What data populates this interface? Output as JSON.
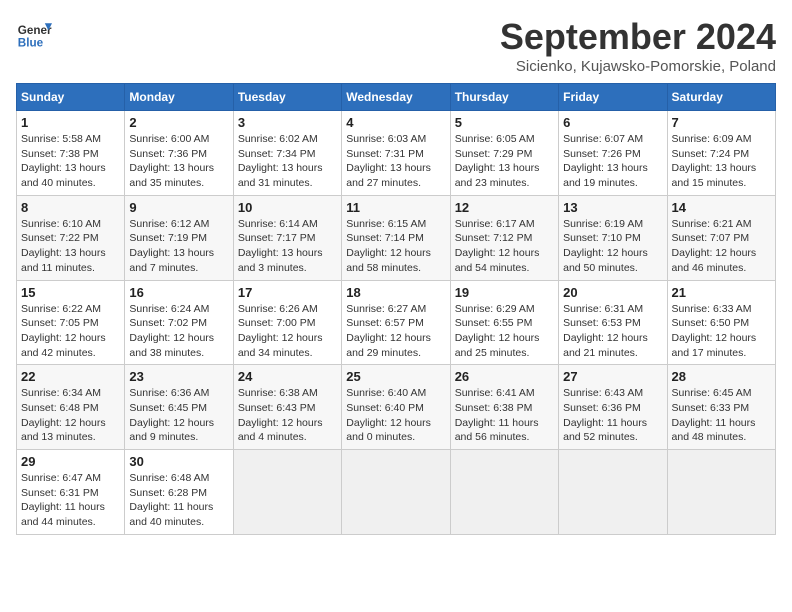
{
  "header": {
    "logo_line1": "General",
    "logo_line2": "Blue",
    "month": "September 2024",
    "location": "Sicienko, Kujawsko-Pomorskie, Poland"
  },
  "weekdays": [
    "Sunday",
    "Monday",
    "Tuesday",
    "Wednesday",
    "Thursday",
    "Friday",
    "Saturday"
  ],
  "weeks": [
    [
      {
        "day": "1",
        "lines": [
          "Sunrise: 5:58 AM",
          "Sunset: 7:38 PM",
          "Daylight: 13 hours",
          "and 40 minutes."
        ]
      },
      {
        "day": "2",
        "lines": [
          "Sunrise: 6:00 AM",
          "Sunset: 7:36 PM",
          "Daylight: 13 hours",
          "and 35 minutes."
        ]
      },
      {
        "day": "3",
        "lines": [
          "Sunrise: 6:02 AM",
          "Sunset: 7:34 PM",
          "Daylight: 13 hours",
          "and 31 minutes."
        ]
      },
      {
        "day": "4",
        "lines": [
          "Sunrise: 6:03 AM",
          "Sunset: 7:31 PM",
          "Daylight: 13 hours",
          "and 27 minutes."
        ]
      },
      {
        "day": "5",
        "lines": [
          "Sunrise: 6:05 AM",
          "Sunset: 7:29 PM",
          "Daylight: 13 hours",
          "and 23 minutes."
        ]
      },
      {
        "day": "6",
        "lines": [
          "Sunrise: 6:07 AM",
          "Sunset: 7:26 PM",
          "Daylight: 13 hours",
          "and 19 minutes."
        ]
      },
      {
        "day": "7",
        "lines": [
          "Sunrise: 6:09 AM",
          "Sunset: 7:24 PM",
          "Daylight: 13 hours",
          "and 15 minutes."
        ]
      }
    ],
    [
      {
        "day": "8",
        "lines": [
          "Sunrise: 6:10 AM",
          "Sunset: 7:22 PM",
          "Daylight: 13 hours",
          "and 11 minutes."
        ]
      },
      {
        "day": "9",
        "lines": [
          "Sunrise: 6:12 AM",
          "Sunset: 7:19 PM",
          "Daylight: 13 hours",
          "and 7 minutes."
        ]
      },
      {
        "day": "10",
        "lines": [
          "Sunrise: 6:14 AM",
          "Sunset: 7:17 PM",
          "Daylight: 13 hours",
          "and 3 minutes."
        ]
      },
      {
        "day": "11",
        "lines": [
          "Sunrise: 6:15 AM",
          "Sunset: 7:14 PM",
          "Daylight: 12 hours",
          "and 58 minutes."
        ]
      },
      {
        "day": "12",
        "lines": [
          "Sunrise: 6:17 AM",
          "Sunset: 7:12 PM",
          "Daylight: 12 hours",
          "and 54 minutes."
        ]
      },
      {
        "day": "13",
        "lines": [
          "Sunrise: 6:19 AM",
          "Sunset: 7:10 PM",
          "Daylight: 12 hours",
          "and 50 minutes."
        ]
      },
      {
        "day": "14",
        "lines": [
          "Sunrise: 6:21 AM",
          "Sunset: 7:07 PM",
          "Daylight: 12 hours",
          "and 46 minutes."
        ]
      }
    ],
    [
      {
        "day": "15",
        "lines": [
          "Sunrise: 6:22 AM",
          "Sunset: 7:05 PM",
          "Daylight: 12 hours",
          "and 42 minutes."
        ]
      },
      {
        "day": "16",
        "lines": [
          "Sunrise: 6:24 AM",
          "Sunset: 7:02 PM",
          "Daylight: 12 hours",
          "and 38 minutes."
        ]
      },
      {
        "day": "17",
        "lines": [
          "Sunrise: 6:26 AM",
          "Sunset: 7:00 PM",
          "Daylight: 12 hours",
          "and 34 minutes."
        ]
      },
      {
        "day": "18",
        "lines": [
          "Sunrise: 6:27 AM",
          "Sunset: 6:57 PM",
          "Daylight: 12 hours",
          "and 29 minutes."
        ]
      },
      {
        "day": "19",
        "lines": [
          "Sunrise: 6:29 AM",
          "Sunset: 6:55 PM",
          "Daylight: 12 hours",
          "and 25 minutes."
        ]
      },
      {
        "day": "20",
        "lines": [
          "Sunrise: 6:31 AM",
          "Sunset: 6:53 PM",
          "Daylight: 12 hours",
          "and 21 minutes."
        ]
      },
      {
        "day": "21",
        "lines": [
          "Sunrise: 6:33 AM",
          "Sunset: 6:50 PM",
          "Daylight: 12 hours",
          "and 17 minutes."
        ]
      }
    ],
    [
      {
        "day": "22",
        "lines": [
          "Sunrise: 6:34 AM",
          "Sunset: 6:48 PM",
          "Daylight: 12 hours",
          "and 13 minutes."
        ]
      },
      {
        "day": "23",
        "lines": [
          "Sunrise: 6:36 AM",
          "Sunset: 6:45 PM",
          "Daylight: 12 hours",
          "and 9 minutes."
        ]
      },
      {
        "day": "24",
        "lines": [
          "Sunrise: 6:38 AM",
          "Sunset: 6:43 PM",
          "Daylight: 12 hours",
          "and 4 minutes."
        ]
      },
      {
        "day": "25",
        "lines": [
          "Sunrise: 6:40 AM",
          "Sunset: 6:40 PM",
          "Daylight: 12 hours",
          "and 0 minutes."
        ]
      },
      {
        "day": "26",
        "lines": [
          "Sunrise: 6:41 AM",
          "Sunset: 6:38 PM",
          "Daylight: 11 hours",
          "and 56 minutes."
        ]
      },
      {
        "day": "27",
        "lines": [
          "Sunrise: 6:43 AM",
          "Sunset: 6:36 PM",
          "Daylight: 11 hours",
          "and 52 minutes."
        ]
      },
      {
        "day": "28",
        "lines": [
          "Sunrise: 6:45 AM",
          "Sunset: 6:33 PM",
          "Daylight: 11 hours",
          "and 48 minutes."
        ]
      }
    ],
    [
      {
        "day": "29",
        "lines": [
          "Sunrise: 6:47 AM",
          "Sunset: 6:31 PM",
          "Daylight: 11 hours",
          "and 44 minutes."
        ]
      },
      {
        "day": "30",
        "lines": [
          "Sunrise: 6:48 AM",
          "Sunset: 6:28 PM",
          "Daylight: 11 hours",
          "and 40 minutes."
        ]
      },
      {
        "day": "",
        "lines": [],
        "empty": true
      },
      {
        "day": "",
        "lines": [],
        "empty": true
      },
      {
        "day": "",
        "lines": [],
        "empty": true
      },
      {
        "day": "",
        "lines": [],
        "empty": true
      },
      {
        "day": "",
        "lines": [],
        "empty": true
      }
    ]
  ]
}
